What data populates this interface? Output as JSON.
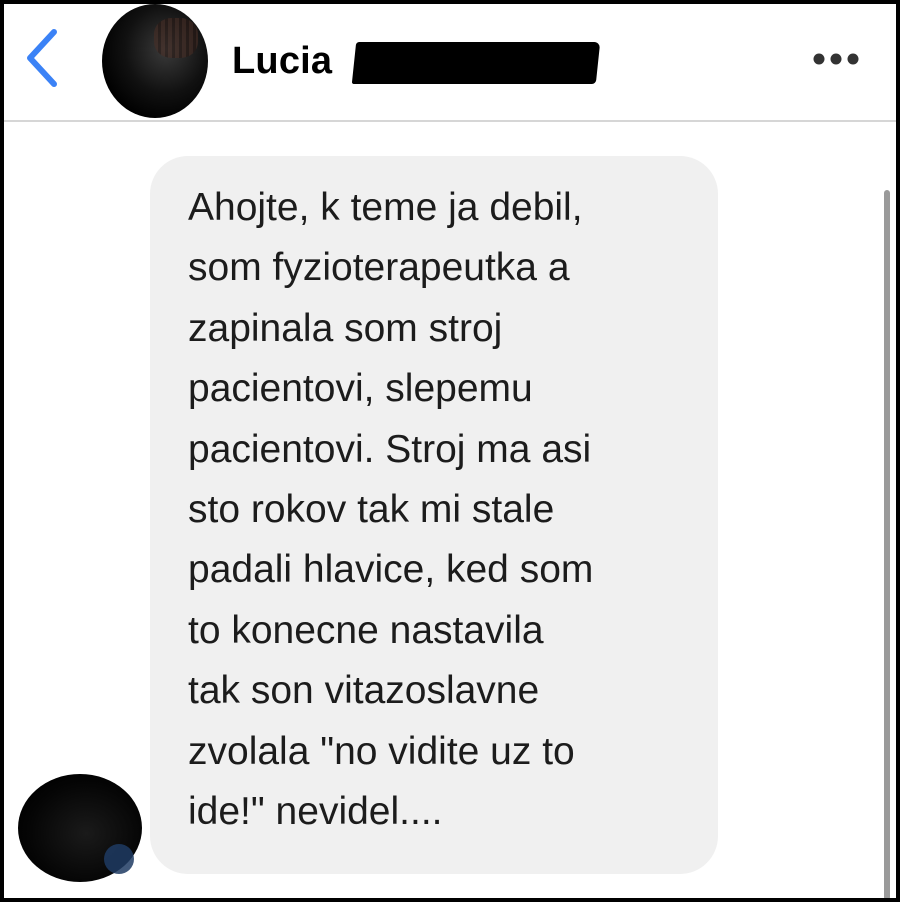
{
  "header": {
    "contact_name": "Lucia",
    "back_icon": "chevron-left-icon",
    "more_icon": "more-dots-icon"
  },
  "message": {
    "text": "Ahojte, k teme ja debil,\nsom fyzioterapeutka a\nzapinala som stroj\npacientovi, slepemu\npacientovi. Stroj ma asi\nsto rokov tak mi stale\npadali hlavice, ked som\nto konecne nastavila\ntak son vitazoslavne\nzvolala \"no vidite uz to\nide!\" nevidel...."
  },
  "colors": {
    "accent": "#3b82f6",
    "bubble": "#f0f0f0",
    "text": "#1c1c1c"
  }
}
